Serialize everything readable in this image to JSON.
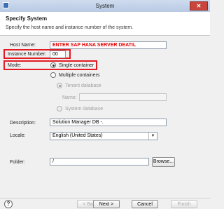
{
  "window": {
    "title": "System",
    "close_glyph": "✕"
  },
  "header": {
    "title": "Specify System",
    "description": "Specify the host name and instance number of the system."
  },
  "form": {
    "host_name_label": "Host Name:",
    "host_name_value": "ENTER SAP HANA SERVER DEATIL",
    "instance_number_label": "Instance Number:",
    "instance_number_value": "00",
    "mode_label": "Mode:",
    "mode_single": "Single container",
    "mode_multiple": "Multiple containers",
    "tenant_database": "Tenant database",
    "name_label": "Name:",
    "system_database": "System database",
    "description_label": "Description:",
    "description_value": "Solution Manager DB -.",
    "locale_label": "Locale:",
    "locale_value": "English (United States)",
    "folder_label": "Folder:",
    "folder_value": "/",
    "browse_button": "Browse..."
  },
  "buttons": {
    "help": "?",
    "back": "< Back",
    "next": "Next >",
    "cancel": "Cancel",
    "finish": "Finish"
  },
  "colors": {
    "annotation": "#e31b23",
    "annotation_text": "#e60000"
  },
  "icons": {
    "window": "window-app-icon",
    "help": "help-icon",
    "dropdown": "chevron-down-icon"
  }
}
